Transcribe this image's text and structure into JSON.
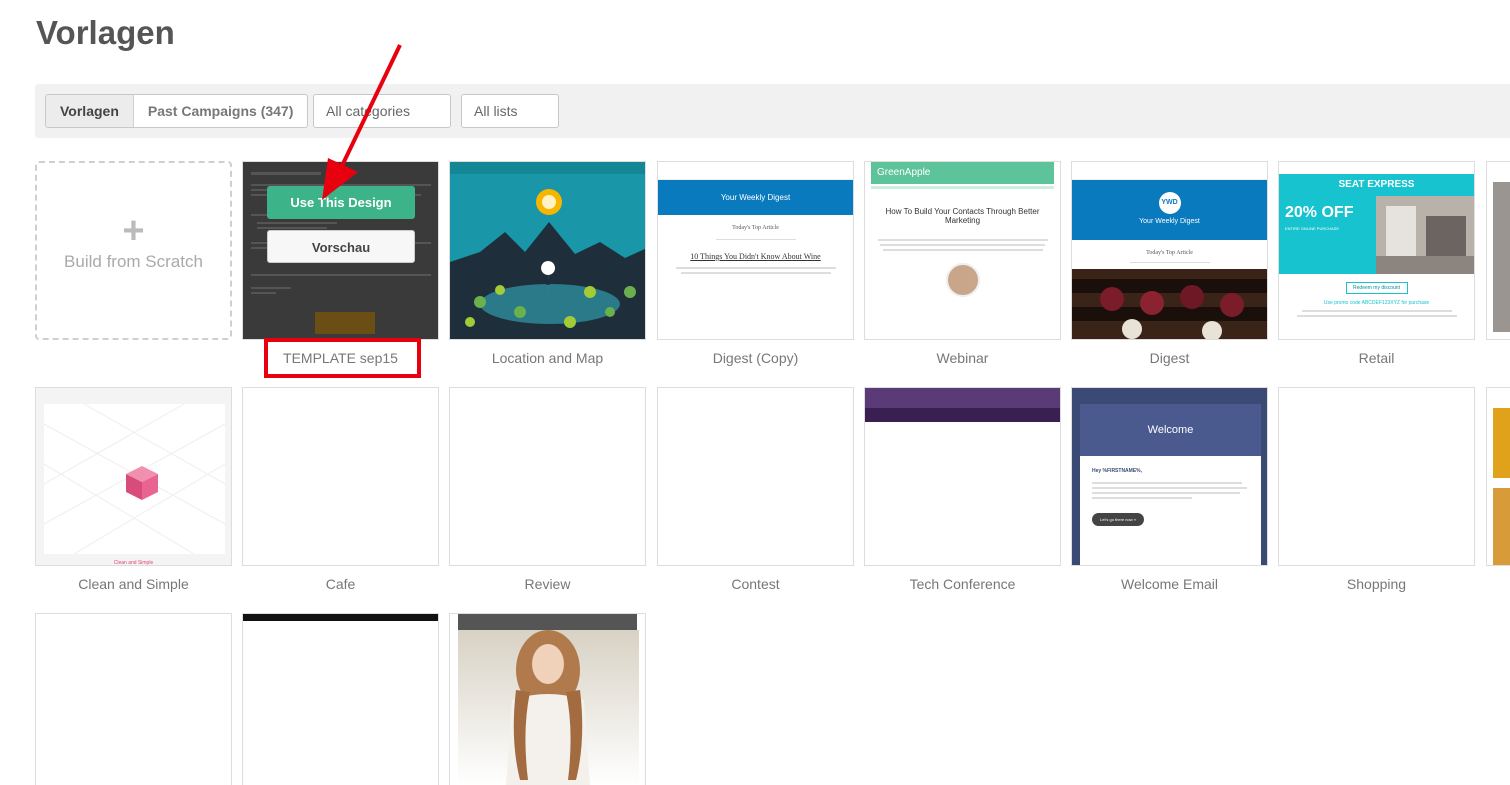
{
  "page": {
    "title": "Vorlagen"
  },
  "toolbar": {
    "tabs": [
      {
        "label": "Vorlagen"
      },
      {
        "label": "Past Campaigns (347)"
      }
    ],
    "category_select": "All categories",
    "list_select": "All lists"
  },
  "scratch": {
    "plus": "+",
    "label": "Build from Scratch"
  },
  "overlay": {
    "use_label": "Use This Design",
    "preview_label": "Vorschau"
  },
  "templates": [
    {
      "name": "TEMPLATE sep15"
    },
    {
      "name": "Location and Map"
    },
    {
      "name": "Digest (Copy)"
    },
    {
      "name": "Webinar"
    },
    {
      "name": "Digest"
    },
    {
      "name": "Retail"
    },
    {
      "name": "Clean and Simple"
    },
    {
      "name": "Cafe"
    },
    {
      "name": "Review"
    },
    {
      "name": "Contest"
    },
    {
      "name": "Tech Conference"
    },
    {
      "name": "Welcome Email"
    },
    {
      "name": "Shopping"
    }
  ],
  "thumbs": {
    "digest_copy": {
      "header": "Your Weekly Digest",
      "sub": "Today's Top Article",
      "headline": "10 Things You Didn't Know About Wine"
    },
    "webinar": {
      "brand": "GreenApple",
      "headline": "How To Build Your Contacts Through Better Marketing"
    },
    "digest": {
      "logo": "YWD",
      "header": "Your Weekly Digest",
      "sub": "Today's Top Article"
    },
    "retail": {
      "brand": "SEAT EXPRESS",
      "offer": "20% OFF",
      "offer_sub": "ENTIRE ONLINE PURCHASE",
      "button": "Redeem my discount",
      "promo": "Use promo code ABCDEF123XYZ for purchase"
    },
    "clean": {
      "caption": "Clean and Simple"
    },
    "welcome": {
      "header": "Welcome",
      "greeting": "Hey %FIRSTNAME%,",
      "button": "Let's go there now »"
    }
  },
  "colors": {
    "accent_green": "#3db389",
    "highlight_red": "#e8000e",
    "digest_blue": "#0a7abf",
    "retail_teal": "#16c3cf"
  }
}
